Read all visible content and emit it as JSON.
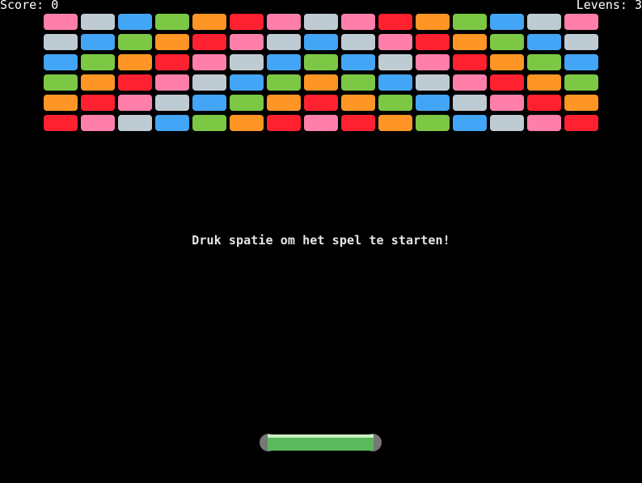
{
  "hud": {
    "score_text": "Score: 0",
    "lives_text": "Levens: 3"
  },
  "message": "Druk spatie om het spel te starten!",
  "colors": {
    "pink": "#ff7eaa",
    "silver": "#bfcbd3",
    "blue": "#42a5f5",
    "green": "#7cc844",
    "orange": "#ff9524",
    "red": "#ff2030",
    "paddle_body": "#5cb85c",
    "paddle_highlight": "#c8f0c0",
    "paddle_cap": "#777777",
    "background": "#000000"
  },
  "bricks": [
    [
      "pink",
      "silver",
      "blue",
      "green",
      "orange",
      "red",
      "pink",
      "silver",
      "pink",
      "red",
      "orange",
      "green",
      "blue",
      "silver",
      "pink"
    ],
    [
      "silver",
      "blue",
      "green",
      "orange",
      "red",
      "pink",
      "silver",
      "blue",
      "silver",
      "pink",
      "red",
      "orange",
      "green",
      "blue",
      "silver"
    ],
    [
      "blue",
      "green",
      "orange",
      "red",
      "pink",
      "silver",
      "blue",
      "green",
      "blue",
      "silver",
      "pink",
      "red",
      "orange",
      "green",
      "blue"
    ],
    [
      "green",
      "orange",
      "red",
      "pink",
      "silver",
      "blue",
      "green",
      "orange",
      "green",
      "blue",
      "silver",
      "pink",
      "red",
      "orange",
      "green"
    ],
    [
      "orange",
      "red",
      "pink",
      "silver",
      "blue",
      "green",
      "orange",
      "red",
      "orange",
      "green",
      "blue",
      "silver",
      "pink",
      "red",
      "orange"
    ],
    [
      "red",
      "pink",
      "silver",
      "blue",
      "green",
      "orange",
      "red",
      "pink",
      "red",
      "orange",
      "green",
      "blue",
      "silver",
      "pink",
      "red"
    ]
  ]
}
